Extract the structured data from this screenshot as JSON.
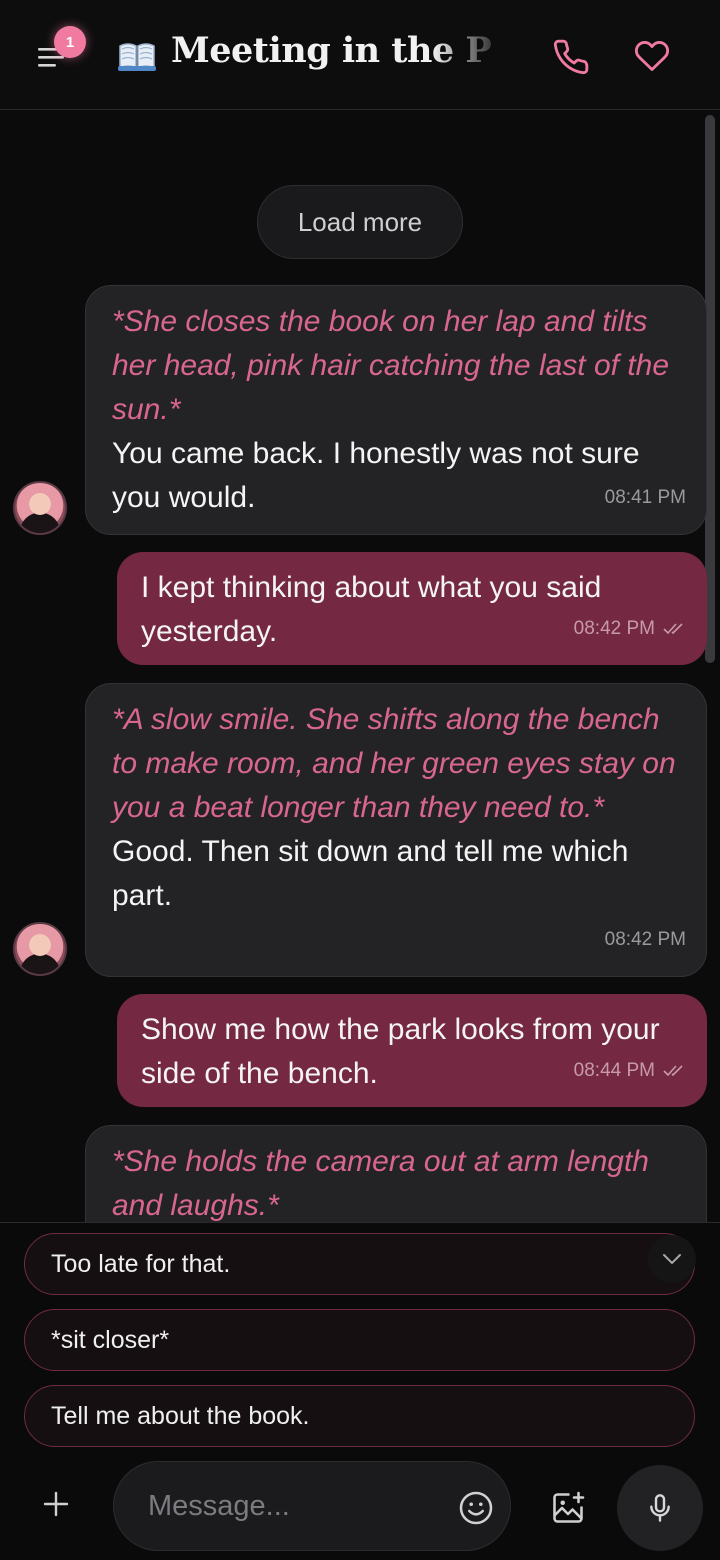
{
  "header": {
    "title": "Meeting in the Park",
    "notification_count": "1",
    "accent_color": "#f07aa0"
  },
  "chat": {
    "load_more_label": "Load more",
    "messages": [
      {
        "from": "character",
        "action": "*She closes the book on her lap and tilts her head, pink hair catching the last of the sun.*",
        "text": "You came back. I honestly was not sure you would.",
        "time": "08:41 PM"
      },
      {
        "from": "user",
        "text": "I kept thinking about what you said yesterday.",
        "time": "08:42 PM",
        "status": "read"
      },
      {
        "from": "character",
        "action": "*A slow smile. She shifts along the bench to make room, and her green eyes stay on you a beat longer than they need to.*",
        "text": "Good. Then sit down and tell me which part.",
        "time": "08:42 PM"
      },
      {
        "from": "user",
        "text": "Show me how the park looks from your side of the bench.",
        "time": "08:44 PM",
        "status": "read"
      },
      {
        "from": "character",
        "action": "*She holds the camera out at arm length and laughs.*"
      }
    ]
  },
  "suggestions": [
    "Too late for that.",
    "*sit closer*",
    "Tell me about the book."
  ],
  "composer": {
    "placeholder": "Message..."
  },
  "icons": {
    "menu": "hamburger-icon",
    "book": "open-book-icon",
    "call": "phone-icon",
    "favorite": "heart-icon",
    "collapse": "chevron-down-icon",
    "add": "plus-icon",
    "emoji": "smiley-icon",
    "image": "add-image-icon",
    "mic": "microphone-icon"
  }
}
